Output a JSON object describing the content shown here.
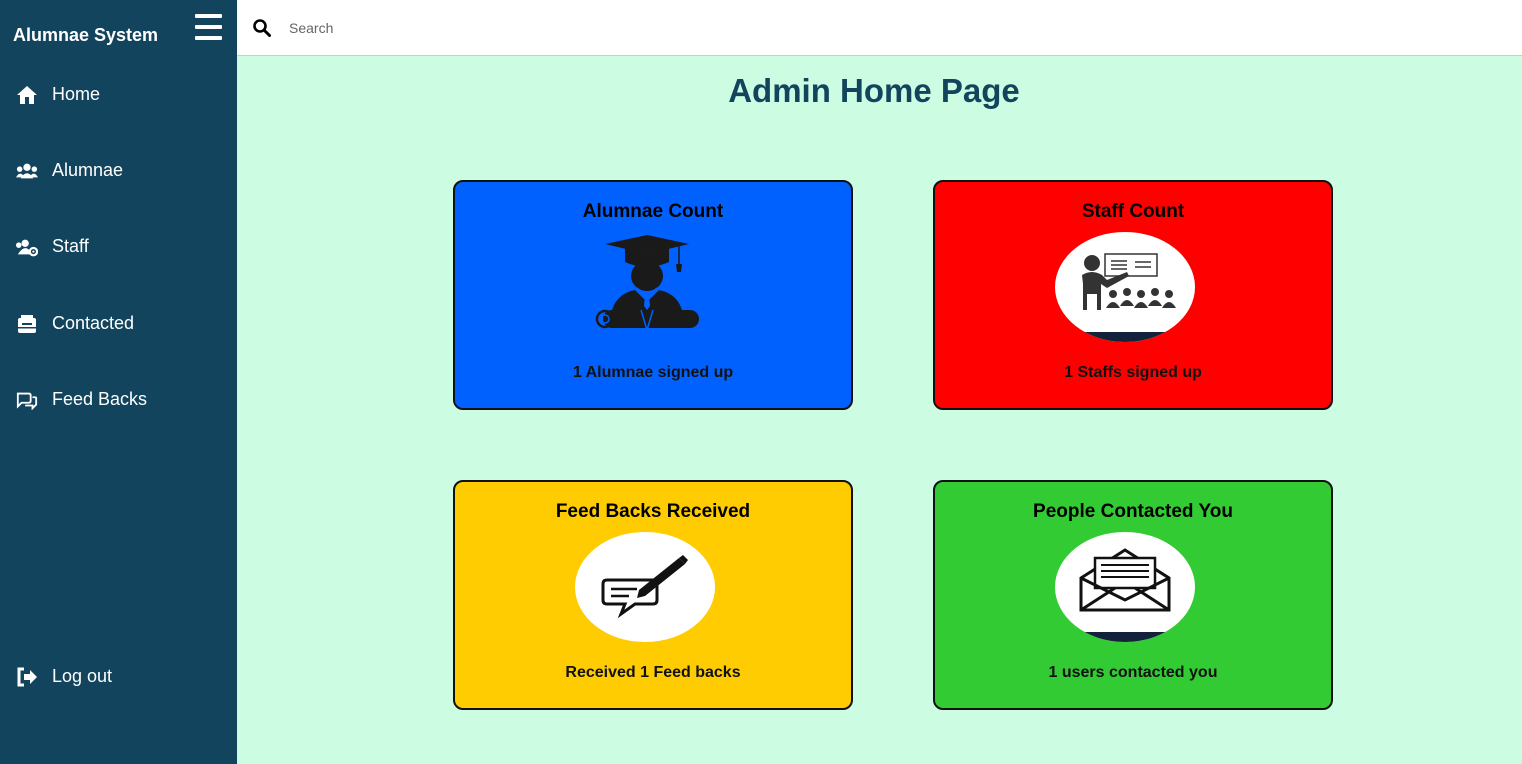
{
  "app": {
    "title": "Alumnae System"
  },
  "sidebar": {
    "items": [
      {
        "label": "Home",
        "icon": "home-icon"
      },
      {
        "label": "Alumnae",
        "icon": "users-icon"
      },
      {
        "label": "Staff",
        "icon": "users-cog-icon"
      },
      {
        "label": "Contacted",
        "icon": "mailbox-icon"
      },
      {
        "label": "Feed Backs",
        "icon": "comments-icon"
      }
    ],
    "logout": {
      "label": "Log out",
      "icon": "sign-out-icon"
    }
  },
  "search": {
    "placeholder": "Search",
    "value": ""
  },
  "main": {
    "title": "Admin Home Page",
    "cards": [
      {
        "title": "Alumnae Count",
        "text": "1 Alumnae signed up",
        "color": "#0061fe",
        "icon": "graduate-icon"
      },
      {
        "title": "Staff Count",
        "text": "1 Staffs signed up",
        "color": "#fe0000",
        "icon": "teacher-icon"
      },
      {
        "title": "Feed Backs Received",
        "text": "Received 1 Feed backs",
        "color": "#fecc00",
        "icon": "feedback-pen-icon"
      },
      {
        "title": "People Contacted You",
        "text": "1 users contacted you",
        "color": "#33cb33",
        "icon": "envelope-open-icon"
      }
    ]
  },
  "colors": {
    "sidebar": "#13445d",
    "background": "#ccfde3",
    "title": "#13445d"
  }
}
